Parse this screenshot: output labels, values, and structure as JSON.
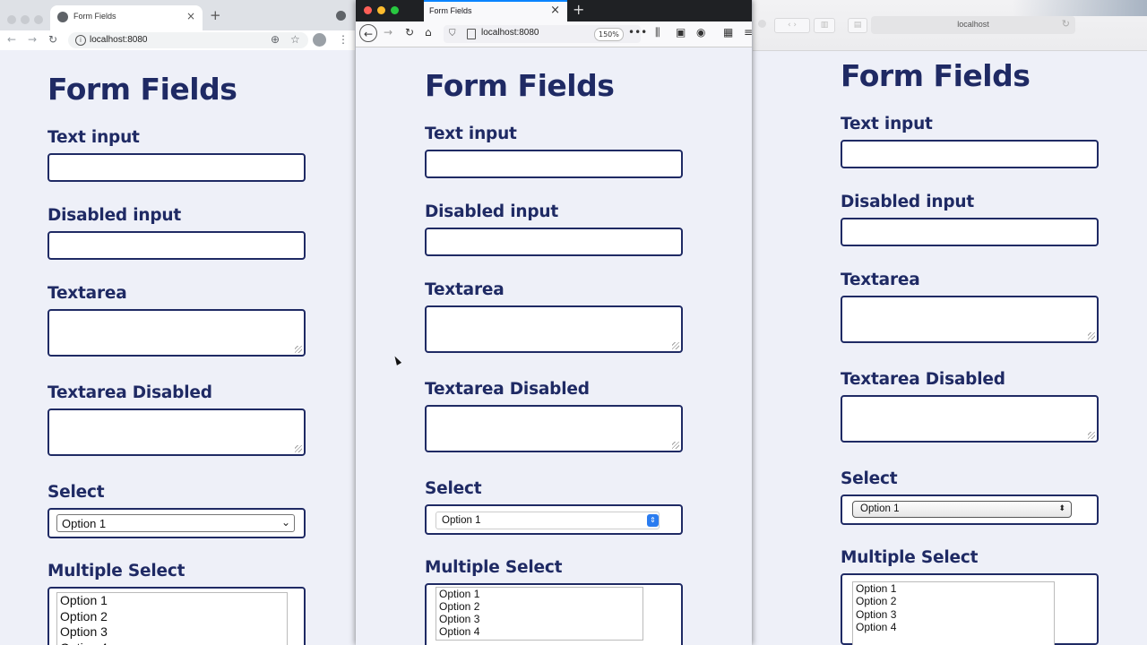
{
  "page": {
    "title": "Form Fields",
    "fields": {
      "text_input_label": "Text input",
      "disabled_input_label": "Disabled input",
      "textarea_label": "Textarea",
      "textarea_disabled_label": "Textarea Disabled",
      "select_label": "Select",
      "select_value": "Option 1",
      "multi_label": "Multiple Select",
      "multi_options": [
        "Option 1",
        "Option 2",
        "Option 3",
        "Option 4"
      ]
    }
  },
  "chrome": {
    "tab_title": "Form Fields",
    "url": "localhost:8080",
    "new_tab": "+",
    "close": "×"
  },
  "firefox": {
    "tab_title": "Form Fields",
    "url": "localhost:8080",
    "zoom": "150%",
    "new_tab": "+",
    "close": "×"
  },
  "safari": {
    "url": "localhost"
  },
  "colors": {
    "heading": "#1f2a64",
    "page_bg": "#eef0f8",
    "firefox_accent": "#0a84ff",
    "select_stepper": "#2a7cf0"
  }
}
